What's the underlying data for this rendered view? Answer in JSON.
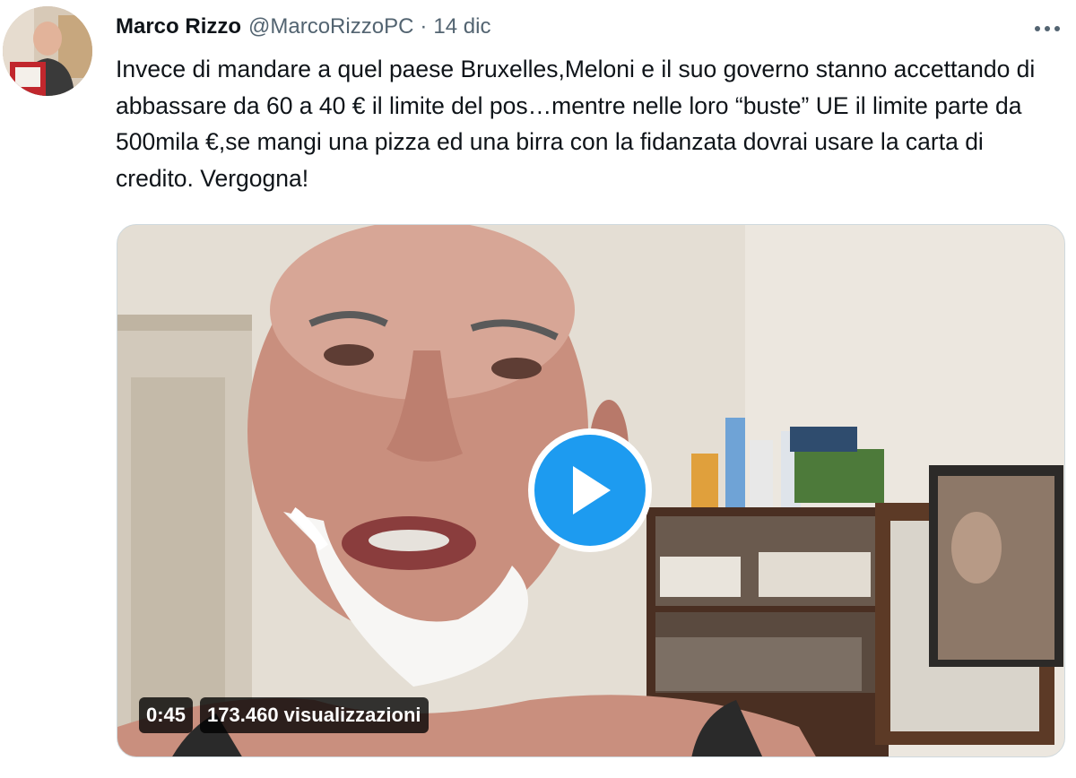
{
  "tweet": {
    "author": {
      "display_name": "Marco Rizzo",
      "handle": "@MarcoRizzoPC",
      "avatar_icon": "profile-photo"
    },
    "separator": "·",
    "timestamp": "14 dic",
    "more_icon": "more-horizontal-icon",
    "text": "Invece di mandare a quel paese Bruxelles,Meloni e il suo governo stanno accettando di abbassare da 60 a 40 € il limite del pos…mentre nelle loro “buste” UE il limite parte da 500mila €,se mangi una pizza ed una birra con la fidanzata dovrai usare la carta di credito. Vergogna!",
    "video": {
      "duration": "0:45",
      "views": "173.460 visualizzazioni",
      "play_icon": "play-icon"
    }
  },
  "colors": {
    "accent": "#1d9bf0",
    "text": "#0f1419",
    "secondary": "#536471"
  }
}
